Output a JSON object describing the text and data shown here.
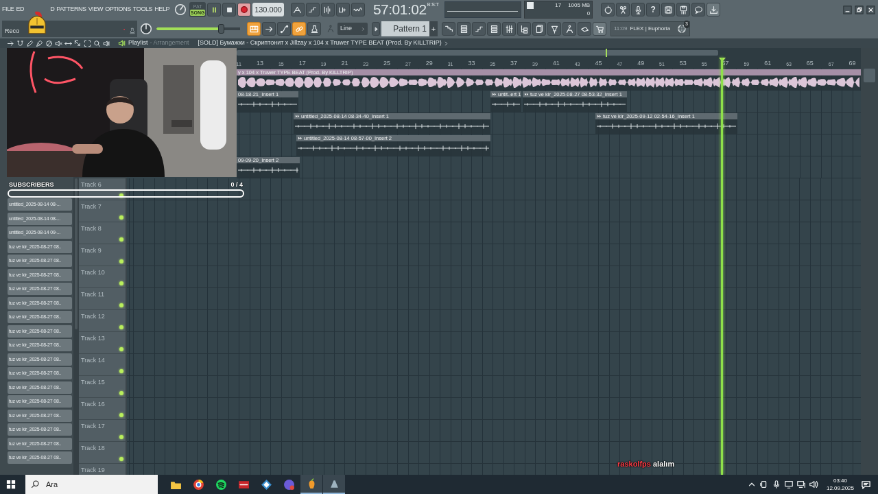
{
  "menu": [
    "FILE",
    "ED",
    "D",
    "PATTERNS",
    "VIEW",
    "OPTIONS",
    "TOOLS",
    "HELP"
  ],
  "hint_panel": {
    "text": "Reco"
  },
  "transport": {
    "modes": [
      {
        "label": "PAT",
        "selected": false
      },
      {
        "label": "SONG",
        "selected": true
      }
    ],
    "playing": true,
    "tempo": "130.000"
  },
  "time": {
    "value": "57:01:02",
    "format": "B:S:T"
  },
  "resources": {
    "cpu": "17",
    "memory": "1005 MB",
    "polyphony": "0"
  },
  "help_label": "?",
  "master_pitch": {
    "level": 0.76
  },
  "tool_toggles": [
    {
      "on": true
    },
    {
      "on": false
    },
    {
      "on": false
    },
    {
      "on": true
    },
    {
      "on": false
    }
  ],
  "snap": {
    "value": "Line"
  },
  "pattern": {
    "value": "Pattern 1",
    "add": "+"
  },
  "news": {
    "time": "11:09",
    "text": "FLEX | Euphoria",
    "badge": "3"
  },
  "playlist": {
    "title": "Playlist",
    "subtitle": "- Arrangement",
    "project": "[SOLD] Бумажки - Скриптонит x Jillzay x 104 x Truwer TYPE BEAT (Prod. By KILLTRIP)",
    "ruler": [
      "11",
      "13",
      "15",
      "17",
      "19",
      "21",
      "23",
      "25",
      "27",
      "29",
      "31",
      "33",
      "35",
      "37",
      "39",
      "41",
      "43",
      "45",
      "47",
      "49",
      "51",
      "53",
      "55",
      "57",
      "59",
      "61",
      "63",
      "65",
      "67",
      "69"
    ],
    "tracks": [
      {
        "clips": [
          {
            "label": "y x 104 x Truwer TYPE BEAT (Prod. By KILLTRIP)",
            "color": "#a58fa6"
          }
        ]
      },
      {
        "clips": [
          {
            "label": "08-18-21_Insert 1",
            "color": "#5f6a70"
          },
          {
            "label": "untit..ert 1",
            "color": "#5f6a70"
          },
          {
            "label": "tuz ve kir_2025-08-27 08-53-32_Insert 1",
            "color": "#5f6a70"
          }
        ]
      },
      {
        "clips": [
          {
            "label": "untitled_2025-08-14 08-34-40_Insert 1",
            "color": "#5f6a70"
          },
          {
            "label": "tuz ve kir_2025-09-12 02-54-16_Insert 1",
            "color": "#5f6a70"
          }
        ]
      },
      {
        "clips": [
          {
            "label": "untitled_2025-08-14 08-57-00_Insert 2",
            "color": "#5f6a70"
          }
        ]
      },
      {
        "clips": [
          {
            "label": "09-09-20_Insert 2",
            "color": "#5f6a70"
          }
        ]
      },
      {
        "name": "Track 6",
        "enabled": true
      },
      {
        "name": "Track 7",
        "enabled": true
      },
      {
        "name": "Track 8",
        "enabled": true
      },
      {
        "name": "Track 9",
        "enabled": true
      },
      {
        "name": "Track 10",
        "enabled": true
      },
      {
        "name": "Track 11",
        "enabled": true
      },
      {
        "name": "Track 12",
        "enabled": true
      },
      {
        "name": "Track 13",
        "enabled": true
      },
      {
        "name": "Track 14",
        "enabled": true
      },
      {
        "name": "Track 15",
        "enabled": true
      },
      {
        "name": "Track 16",
        "enabled": true
      },
      {
        "name": "Track 17",
        "enabled": true
      },
      {
        "name": "Track 18",
        "enabled": true
      },
      {
        "name": "Track 19"
      }
    ]
  },
  "browser": {
    "items": [
      "untitled_2025-08-14 08-...",
      "untitled_2025-08-14 08-...",
      "untitled_2025-08-14 09-...",
      "tuz ve kir_2025-08-27 08..",
      "tuz ve kir_2025-08-27 08..",
      "tuz ve kir_2025-08-27 08..",
      "tuz ve kir_2025-08-27 08..",
      "tuz ve kir_2025-08-27 08..",
      "tuz ve kir_2025-08-27 08..",
      "tuz ve kir_2025-08-27 08..",
      "tuz ve kir_2025-08-27 08..",
      "tuz ve kir_2025-08-27 08..",
      "tuz ve kir_2025-08-27 08..",
      "tuz ve kir_2025-08-27 08..",
      "tuz ve kir_2025-08-27 08..",
      "tuz ve kir_2025-08-27 08..",
      "tuz ve kir_2025-08-27 08..",
      "tuz ve kir_2025-08-27 08..",
      "tuz ve kir_2025-08-27 08.."
    ]
  },
  "overlays": {
    "subscribers": {
      "title": "SUBSCRIBERS",
      "count": "0 / 4",
      "level": 0
    },
    "chat": {
      "user": "raskolfps",
      "message": "alalım"
    }
  },
  "taskbar": {
    "placeholder": "Ara",
    "apps": [
      {
        "active": false
      },
      {
        "active": false
      },
      {
        "active": false
      },
      {
        "active": false
      },
      {
        "active": false
      },
      {
        "active": false
      },
      {
        "active": true
      },
      {
        "active": true
      }
    ],
    "time": "03:40",
    "date": "12.09.2025"
  }
}
